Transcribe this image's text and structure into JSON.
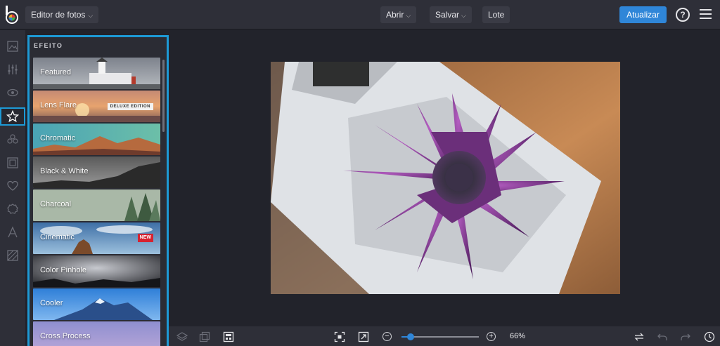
{
  "topbar": {
    "app_selector": "Editor de fotos",
    "open": "Abrir",
    "save": "Salvar",
    "batch": "Lote",
    "update": "Atualizar",
    "help": "?"
  },
  "panel": {
    "title": "EFEITO",
    "effects": [
      {
        "label": "Featured"
      },
      {
        "label": "Lens Flare",
        "badge": "DELUXE EDITION"
      },
      {
        "label": "Chromatic"
      },
      {
        "label": "Black & White"
      },
      {
        "label": "Charcoal"
      },
      {
        "label": "Cinematic",
        "badge": "NEW"
      },
      {
        "label": "Color Pinhole"
      },
      {
        "label": "Cooler"
      },
      {
        "label": "Cross Process"
      }
    ]
  },
  "zoom": {
    "value": "66%",
    "minus": "−",
    "plus": "+"
  },
  "colors": {
    "accent": "#1d9ad6",
    "update_button": "#2f86d8",
    "new_badge": "#d62230"
  }
}
